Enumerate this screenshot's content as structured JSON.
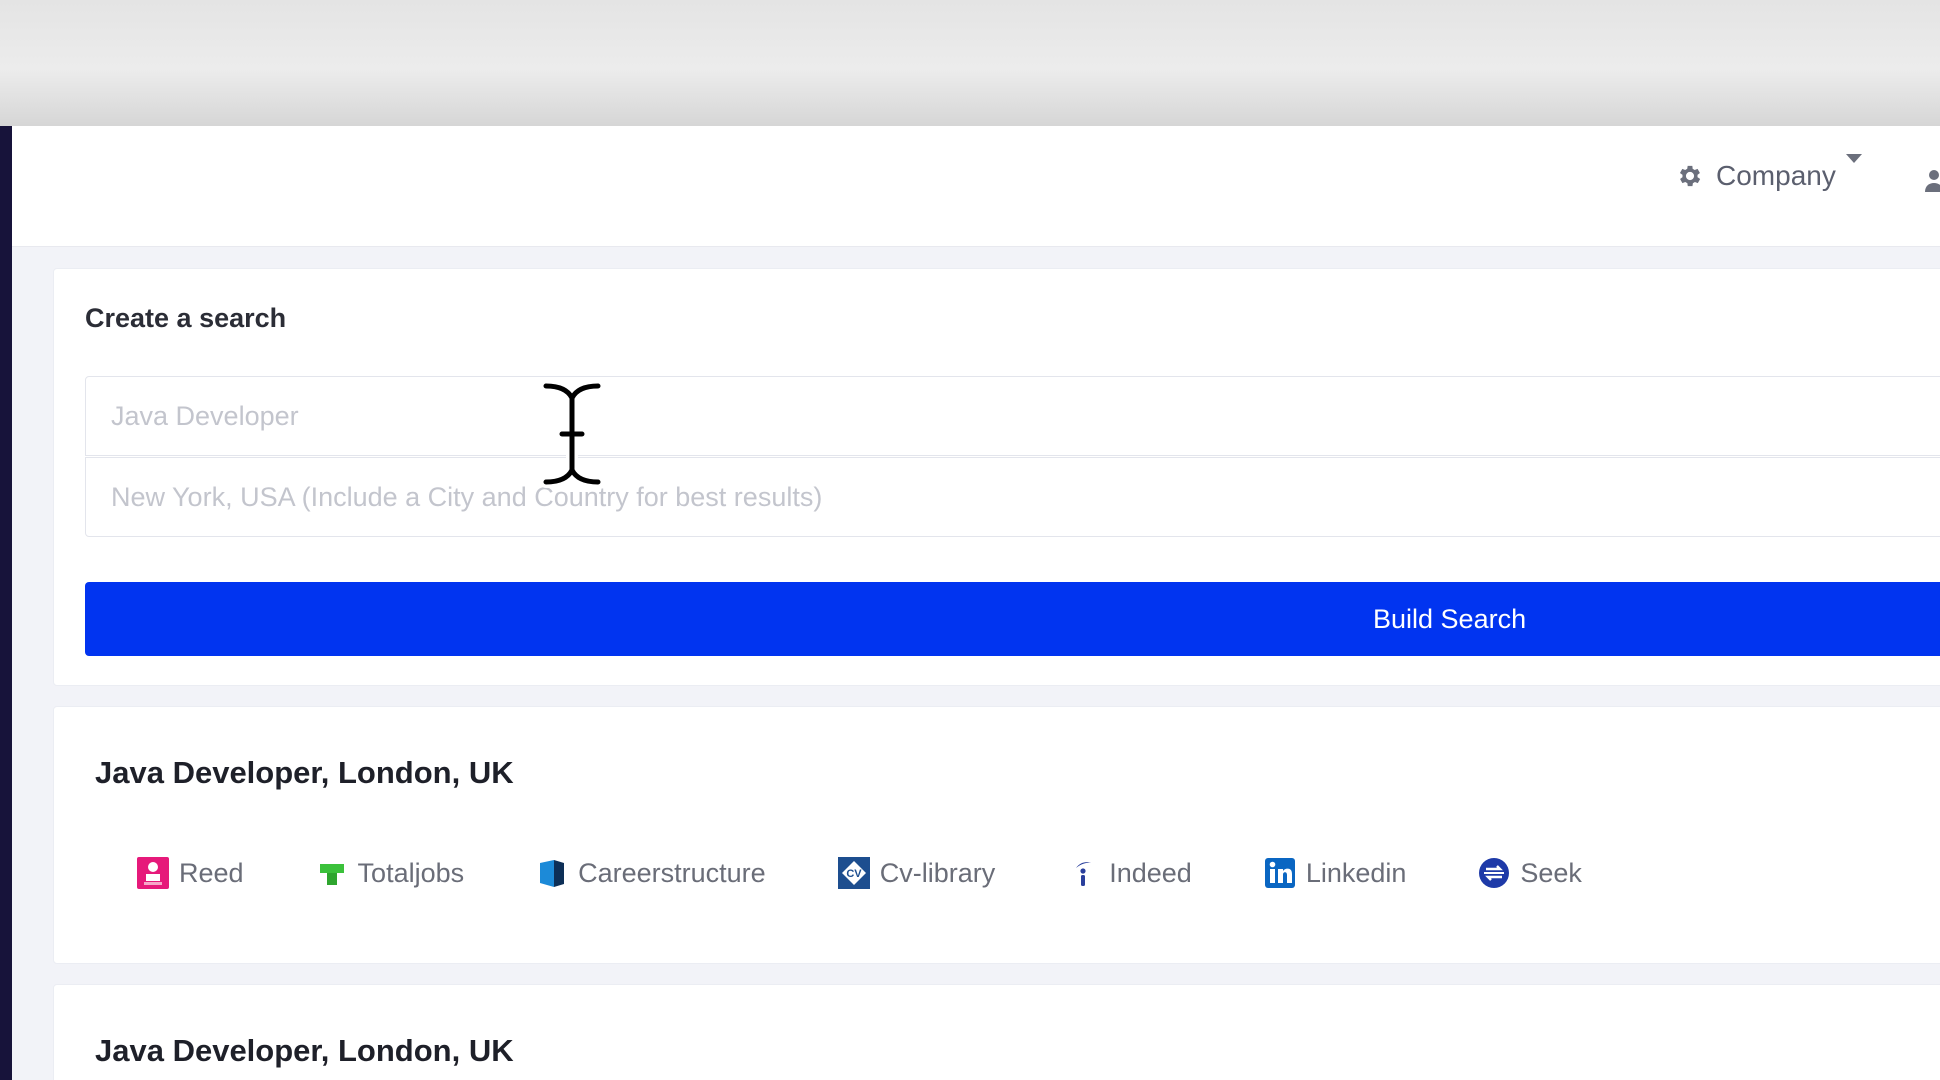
{
  "header": {
    "company_label": "Company"
  },
  "create_search": {
    "title": "Create a search",
    "job_title_placeholder": "Java Developer",
    "location_placeholder": "New York, USA (Include a City and Country for best results)",
    "build_button_label": "Build Search"
  },
  "saved_searches": [
    {
      "title": "Java Developer, London, UK",
      "boards": [
        {
          "label": "Reed",
          "icon": "reed-icon",
          "color": "#e6197a"
        },
        {
          "label": "Totaljobs",
          "icon": "totaljobs-icon",
          "color": "#3bc13b"
        },
        {
          "label": "Careerstructure",
          "icon": "careerstructure-icon",
          "color": "#1c5c9c"
        },
        {
          "label": "Cv-library",
          "icon": "cv-library-icon",
          "color": "#1d4e8f"
        },
        {
          "label": "Indeed",
          "icon": "indeed-icon",
          "color": "#2a3f9c"
        },
        {
          "label": "Linkedin",
          "icon": "linkedin-icon",
          "color": "#0a66c2"
        },
        {
          "label": "Seek",
          "icon": "seek-icon",
          "color": "#1e3aa8"
        }
      ]
    },
    {
      "title": "Java Developer, London, UK"
    }
  ],
  "colors": {
    "primary_button": "#0134f0",
    "page_background": "#f2f3f8"
  }
}
